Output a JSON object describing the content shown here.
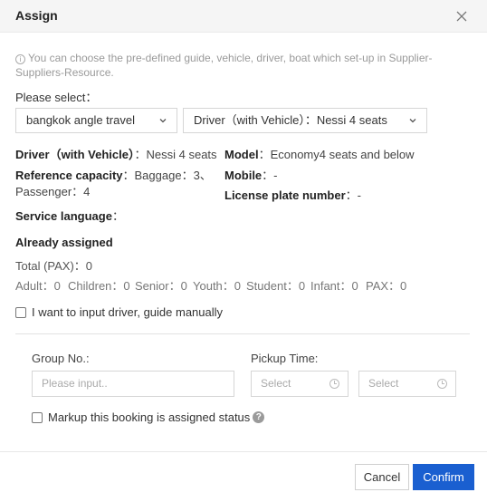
{
  "header": {
    "title": "Assign"
  },
  "info_text": "You can choose the pre-defined guide, vehicle, driver, boat which set-up in Supplier-Suppliers-Resource.",
  "info_icon": "i",
  "please_select": "Please select：",
  "selects": {
    "supplier": "bangkok angle travel",
    "resource": "Driver（with Vehicle）：Nessi 4 seats"
  },
  "details": {
    "driver_label": "Driver（with Vehicle）",
    "driver_value": "：Nessi 4 seats",
    "model_label": "Model",
    "model_value": "：Economy4 seats and below",
    "capacity_label": "Reference capacity",
    "capacity_value": "：Baggage：3、",
    "capacity_value2": "Passenger：4",
    "mobile_label": "Mobile",
    "mobile_value": "：-",
    "plate_label": "License plate number",
    "plate_value": "：-",
    "language_label": "Service language",
    "language_value": "："
  },
  "assigned": {
    "title": "Already assigned",
    "total": "Total (PAX)：0",
    "adult": "Adult：0",
    "children": "Children：0",
    "senior": "Senior：0",
    "youth": "Youth：0",
    "student": "Student：0",
    "infant": "Infant：0",
    "pax": "PAX：0"
  },
  "manual_checkbox": "I want to input driver, guide manually",
  "form": {
    "group_label": "Group No.:",
    "group_placeholder": "Please input..",
    "pickup_label": "Pickup Time:",
    "pickup_date": "Select",
    "pickup_time": "Select",
    "markup_checkbox": "Markup this booking is assigned status",
    "help_icon": "?"
  },
  "footer": {
    "cancel": "Cancel",
    "confirm": "Confirm"
  }
}
